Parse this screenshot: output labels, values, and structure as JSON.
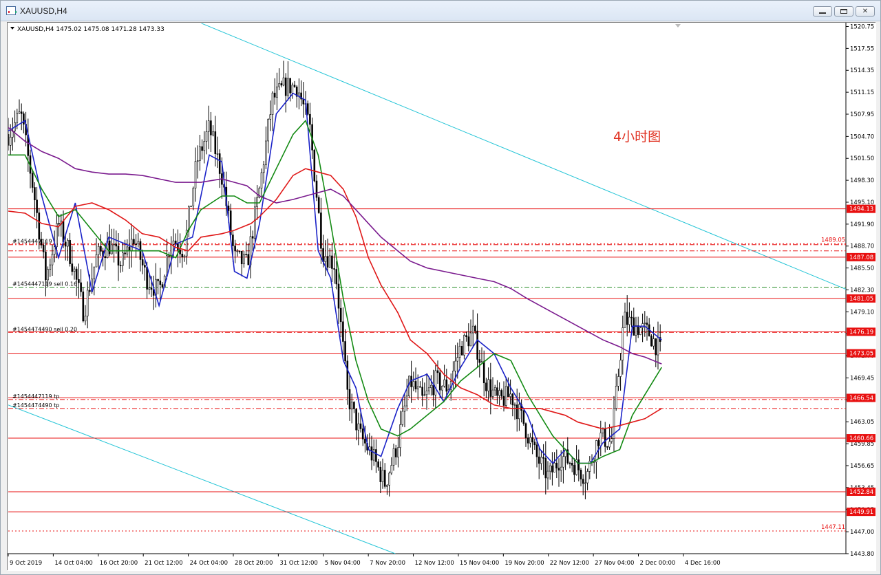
{
  "window": {
    "title": "XAUUSD,H4",
    "buttons": {
      "minimize": "",
      "maximize": "",
      "close": "✕"
    }
  },
  "chart_header": {
    "symbol": "XAUUSD,H4",
    "ohlc": "1475.02 1475.08 1471.28 1473.33"
  },
  "annotation": {
    "text": "4小时图",
    "color": "#e03020"
  },
  "colors": {
    "channel": "#22c4d6",
    "level": "#e81010",
    "ma_fast": "#1a22c8",
    "ma_mid": "#138a13",
    "ma_red": "#e01818",
    "ma_slow": "#7a1a8e",
    "trade_dash": "#228b22",
    "candle": "#000000"
  },
  "chart_data": {
    "type": "candlestick",
    "symbol": "XAUUSD",
    "timeframe": "H4",
    "ylim": [
      1443.8,
      1521.2
    ],
    "y_ticks": [
      "1520.75",
      "1517.55",
      "1514.35",
      "1511.15",
      "1507.95",
      "1504.70",
      "1501.50",
      "1498.30",
      "1495.10",
      "1491.90",
      "1488.70",
      "1485.50",
      "1482.30",
      "1479.10",
      "1475.90",
      "1472.70",
      "1469.45",
      "1466.25",
      "1463.05",
      "1459.85",
      "1456.65",
      "1453.45",
      "1450.25",
      "1447.00",
      "1443.80"
    ],
    "x_ticks": [
      "9 Oct 2019",
      "14 Oct 04:00",
      "16 Oct 20:00",
      "21 Oct 12:00",
      "24 Oct 04:00",
      "28 Oct 20:00",
      "31 Oct 12:00",
      "5 Nov 04:00",
      "7 Nov 20:00",
      "12 Nov 12:00",
      "15 Nov 04:00",
      "19 Nov 20:00",
      "22 Nov 12:00",
      "27 Nov 04:00",
      "2 Dec 00:00",
      "4 Dec 16:00"
    ],
    "price_levels": [
      {
        "label": "1494.13",
        "value": 1494.13
      },
      {
        "label": "1487.08",
        "value": 1487.08
      },
      {
        "label": "1481.05",
        "value": 1481.05
      },
      {
        "label": "1476.19",
        "value": 1476.19
      },
      {
        "label": "1473.05",
        "value": 1473.05
      },
      {
        "label": "1466.54",
        "value": 1466.54
      },
      {
        "label": "1460.66",
        "value": 1460.66
      },
      {
        "label": "1452.84",
        "value": 1452.84
      },
      {
        "label": "1449.91",
        "value": 1449.91
      }
    ],
    "dashed_levels": [
      {
        "label": "1489.05",
        "value": 1489.05
      },
      {
        "label": "1447.11",
        "value": 1447.11
      }
    ],
    "trade_lines": [
      {
        "label": "#1454447119",
        "value": 1488.9,
        "style": "dash-dot",
        "color": "red"
      },
      {
        "label": "",
        "value": 1488.0,
        "style": "dash-dot",
        "color": "red"
      },
      {
        "label": "#1454447119 sell 0.16",
        "value": 1482.7,
        "style": "dash-dot",
        "color": "green"
      },
      {
        "label": "#1454474490 sell 0.20",
        "value": 1476.1,
        "style": "dash-dot",
        "color": "red"
      },
      {
        "label": "#1454447119 tp",
        "value": 1466.3,
        "style": "dash-dot",
        "color": "red"
      },
      {
        "label": "#1454474490 tp",
        "value": 1465.0,
        "style": "dash-dot",
        "color": "red"
      }
    ],
    "channel_lines": [
      {
        "from": [
          0.215,
          1522.0
        ],
        "to": [
          1.0,
          1482.4
        ]
      },
      {
        "from": [
          0.0,
          1465.5
        ],
        "to": [
          0.462,
          1443.8
        ]
      }
    ],
    "moving_averages": [
      {
        "color_key": "ma_fast",
        "points": [
          [
            0.0,
            1505.5
          ],
          [
            0.02,
            1507
          ],
          [
            0.04,
            1496
          ],
          [
            0.06,
            1487
          ],
          [
            0.08,
            1495
          ],
          [
            0.1,
            1482
          ],
          [
            0.12,
            1490
          ],
          [
            0.14,
            1489
          ],
          [
            0.16,
            1488
          ],
          [
            0.18,
            1480
          ],
          [
            0.2,
            1489
          ],
          [
            0.22,
            1490
          ],
          [
            0.24,
            1502
          ],
          [
            0.255,
            1501
          ],
          [
            0.27,
            1485
          ],
          [
            0.285,
            1484
          ],
          [
            0.3,
            1492
          ],
          [
            0.32,
            1508
          ],
          [
            0.34,
            1511
          ],
          [
            0.355,
            1510
          ],
          [
            0.37,
            1488
          ],
          [
            0.385,
            1484
          ],
          [
            0.4,
            1472
          ],
          [
            0.415,
            1468
          ],
          [
            0.43,
            1459
          ],
          [
            0.445,
            1458
          ],
          [
            0.465,
            1465
          ],
          [
            0.48,
            1469
          ],
          [
            0.5,
            1470
          ],
          [
            0.52,
            1466
          ],
          [
            0.54,
            1471
          ],
          [
            0.56,
            1475
          ],
          [
            0.58,
            1473
          ],
          [
            0.6,
            1468
          ],
          [
            0.62,
            1464
          ],
          [
            0.635,
            1459
          ],
          [
            0.65,
            1457
          ],
          [
            0.665,
            1459
          ],
          [
            0.68,
            1457
          ],
          [
            0.695,
            1457
          ],
          [
            0.71,
            1460
          ],
          [
            0.73,
            1462
          ],
          [
            0.745,
            1477
          ],
          [
            0.76,
            1477
          ],
          [
            0.78,
            1475
          ]
        ]
      },
      {
        "color_key": "ma_mid",
        "points": [
          [
            0.0,
            1502
          ],
          [
            0.02,
            1502
          ],
          [
            0.04,
            1497
          ],
          [
            0.06,
            1493
          ],
          [
            0.08,
            1494
          ],
          [
            0.1,
            1491
          ],
          [
            0.12,
            1488
          ],
          [
            0.14,
            1488
          ],
          [
            0.16,
            1488
          ],
          [
            0.18,
            1488
          ],
          [
            0.2,
            1487
          ],
          [
            0.215,
            1491
          ],
          [
            0.23,
            1494
          ],
          [
            0.255,
            1496
          ],
          [
            0.27,
            1496
          ],
          [
            0.285,
            1495
          ],
          [
            0.3,
            1495
          ],
          [
            0.32,
            1500
          ],
          [
            0.34,
            1505
          ],
          [
            0.355,
            1507
          ],
          [
            0.37,
            1502
          ],
          [
            0.385,
            1492
          ],
          [
            0.4,
            1481
          ],
          [
            0.415,
            1472
          ],
          [
            0.43,
            1466
          ],
          [
            0.445,
            1462
          ],
          [
            0.465,
            1461
          ],
          [
            0.48,
            1462
          ],
          [
            0.5,
            1464
          ],
          [
            0.52,
            1466
          ],
          [
            0.54,
            1469
          ],
          [
            0.56,
            1471
          ],
          [
            0.58,
            1473
          ],
          [
            0.6,
            1472
          ],
          [
            0.62,
            1467
          ],
          [
            0.635,
            1464
          ],
          [
            0.65,
            1461
          ],
          [
            0.665,
            1459
          ],
          [
            0.68,
            1457
          ],
          [
            0.695,
            1457
          ],
          [
            0.71,
            1458
          ],
          [
            0.73,
            1459
          ],
          [
            0.745,
            1464
          ],
          [
            0.76,
            1467
          ],
          [
            0.78,
            1471
          ]
        ]
      },
      {
        "color_key": "ma_red",
        "points": [
          [
            0.0,
            1493.8
          ],
          [
            0.02,
            1493.5
          ],
          [
            0.04,
            1492
          ],
          [
            0.06,
            1491.5
          ],
          [
            0.08,
            1494.5
          ],
          [
            0.1,
            1495
          ],
          [
            0.12,
            1494
          ],
          [
            0.14,
            1492.5
          ],
          [
            0.16,
            1490.5
          ],
          [
            0.18,
            1490
          ],
          [
            0.2,
            1488.5
          ],
          [
            0.215,
            1488
          ],
          [
            0.23,
            1490
          ],
          [
            0.255,
            1490.5
          ],
          [
            0.27,
            1491
          ],
          [
            0.29,
            1492
          ],
          [
            0.3,
            1493
          ],
          [
            0.32,
            1495.5
          ],
          [
            0.34,
            1499
          ],
          [
            0.355,
            1500
          ],
          [
            0.37,
            1499.5
          ],
          [
            0.385,
            1499
          ],
          [
            0.4,
            1497
          ],
          [
            0.415,
            1493
          ],
          [
            0.43,
            1487
          ],
          [
            0.445,
            1483
          ],
          [
            0.465,
            1479
          ],
          [
            0.48,
            1475
          ],
          [
            0.5,
            1473
          ],
          [
            0.52,
            1470
          ],
          [
            0.54,
            1468
          ],
          [
            0.56,
            1467
          ],
          [
            0.58,
            1465.5
          ],
          [
            0.6,
            1465
          ],
          [
            0.62,
            1465
          ],
          [
            0.635,
            1465
          ],
          [
            0.65,
            1464.5
          ],
          [
            0.665,
            1464
          ],
          [
            0.68,
            1463
          ],
          [
            0.695,
            1462.5
          ],
          [
            0.71,
            1462
          ],
          [
            0.73,
            1462.5
          ],
          [
            0.745,
            1463
          ],
          [
            0.76,
            1463.5
          ],
          [
            0.78,
            1465
          ]
        ]
      },
      {
        "color_key": "ma_slow",
        "points": [
          [
            0.0,
            1506
          ],
          [
            0.02,
            1504
          ],
          [
            0.04,
            1502.5
          ],
          [
            0.06,
            1501.5
          ],
          [
            0.08,
            1500
          ],
          [
            0.1,
            1499.5
          ],
          [
            0.12,
            1499.2
          ],
          [
            0.14,
            1499.2
          ],
          [
            0.16,
            1499
          ],
          [
            0.18,
            1498.5
          ],
          [
            0.2,
            1498
          ],
          [
            0.215,
            1498
          ],
          [
            0.23,
            1498
          ],
          [
            0.255,
            1498.5
          ],
          [
            0.27,
            1498
          ],
          [
            0.285,
            1497.5
          ],
          [
            0.3,
            1496
          ],
          [
            0.32,
            1495
          ],
          [
            0.34,
            1495.5
          ],
          [
            0.355,
            1496
          ],
          [
            0.37,
            1496.5
          ],
          [
            0.385,
            1497
          ],
          [
            0.4,
            1496
          ],
          [
            0.415,
            1494
          ],
          [
            0.43,
            1492
          ],
          [
            0.445,
            1490
          ],
          [
            0.465,
            1488
          ],
          [
            0.48,
            1486.5
          ],
          [
            0.5,
            1485.5
          ],
          [
            0.52,
            1485
          ],
          [
            0.54,
            1484.5
          ],
          [
            0.56,
            1484
          ],
          [
            0.58,
            1483.5
          ],
          [
            0.6,
            1482.5
          ],
          [
            0.62,
            1481
          ],
          [
            0.635,
            1480
          ],
          [
            0.65,
            1479
          ],
          [
            0.665,
            1478
          ],
          [
            0.68,
            1477
          ],
          [
            0.695,
            1476
          ],
          [
            0.71,
            1475
          ],
          [
            0.73,
            1474
          ],
          [
            0.745,
            1473
          ],
          [
            0.76,
            1472.5
          ],
          [
            0.78,
            1471.5
          ]
        ]
      }
    ],
    "price_path": [
      [
        0.0,
        1505
      ],
      [
        0.015,
        1508
      ],
      [
        0.03,
        1497
      ],
      [
        0.045,
        1484
      ],
      [
        0.06,
        1492
      ],
      [
        0.075,
        1487
      ],
      [
        0.09,
        1479
      ],
      [
        0.105,
        1487
      ],
      [
        0.12,
        1489
      ],
      [
        0.135,
        1486
      ],
      [
        0.15,
        1490
      ],
      [
        0.165,
        1484
      ],
      [
        0.18,
        1482
      ],
      [
        0.195,
        1490
      ],
      [
        0.21,
        1488
      ],
      [
        0.225,
        1501
      ],
      [
        0.24,
        1506
      ],
      [
        0.255,
        1499
      ],
      [
        0.27,
        1487
      ],
      [
        0.285,
        1486
      ],
      [
        0.3,
        1497
      ],
      [
        0.315,
        1510
      ],
      [
        0.33,
        1512
      ],
      [
        0.345,
        1512
      ],
      [
        0.36,
        1506
      ],
      [
        0.375,
        1488
      ],
      [
        0.39,
        1486
      ],
      [
        0.405,
        1467
      ],
      [
        0.42,
        1461
      ],
      [
        0.435,
        1458
      ],
      [
        0.45,
        1454
      ],
      [
        0.465,
        1460
      ],
      [
        0.48,
        1469
      ],
      [
        0.495,
        1466
      ],
      [
        0.51,
        1469
      ],
      [
        0.525,
        1468
      ],
      [
        0.54,
        1474
      ],
      [
        0.555,
        1476
      ],
      [
        0.57,
        1469
      ],
      [
        0.585,
        1466
      ],
      [
        0.6,
        1467
      ],
      [
        0.615,
        1463
      ],
      [
        0.63,
        1458
      ],
      [
        0.645,
        1455
      ],
      [
        0.66,
        1458
      ],
      [
        0.675,
        1457
      ],
      [
        0.69,
        1455
      ],
      [
        0.705,
        1461
      ],
      [
        0.72,
        1460
      ],
      [
        0.735,
        1478
      ],
      [
        0.75,
        1477
      ],
      [
        0.765,
        1476
      ],
      [
        0.78,
        1473
      ]
    ]
  }
}
